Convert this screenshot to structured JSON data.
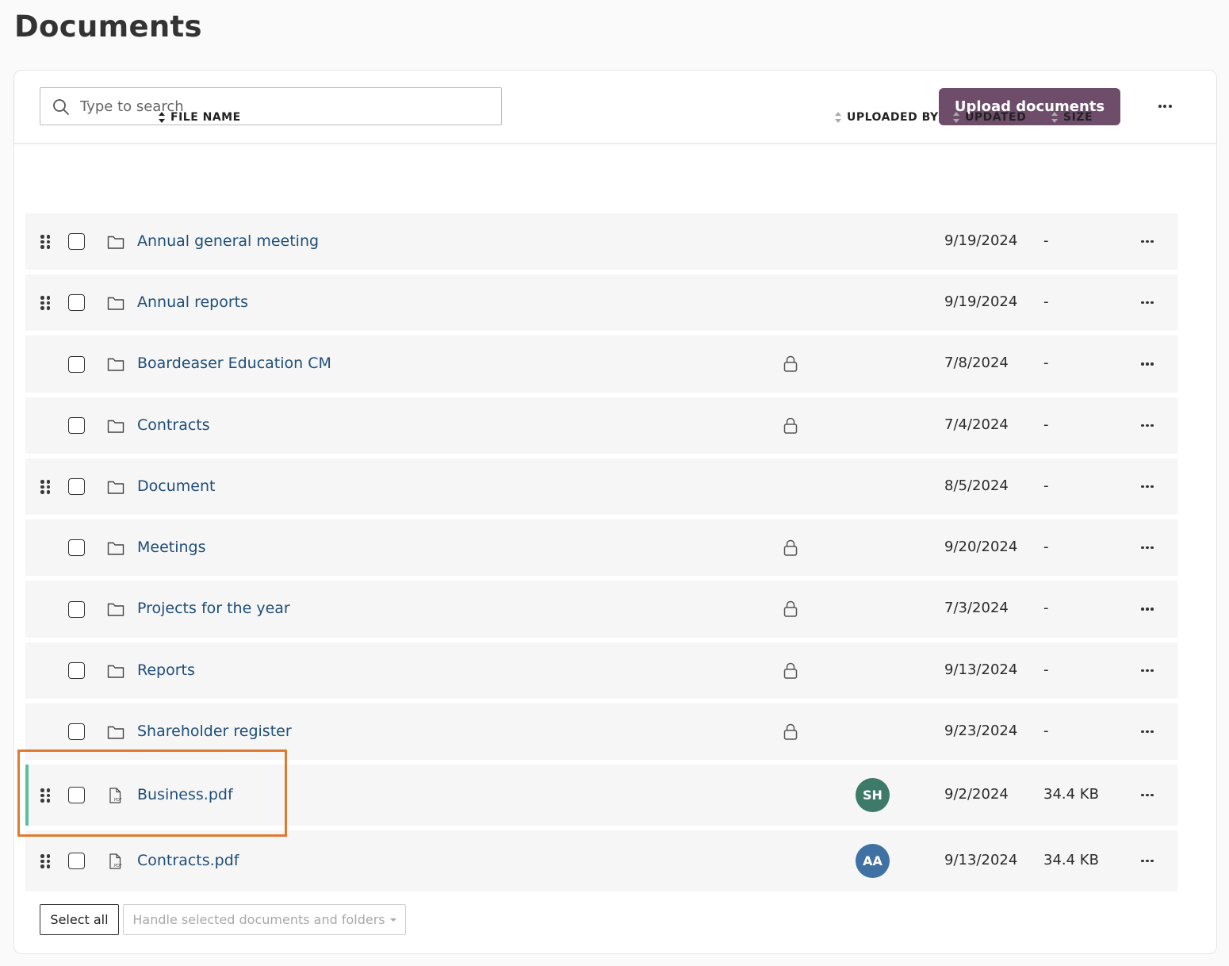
{
  "page": {
    "title": "Documents"
  },
  "toolbar": {
    "search_placeholder": "Type to search",
    "search_value": "",
    "upload_label": "Upload documents"
  },
  "columns": {
    "file_name": "FILE NAME",
    "uploaded_by": "UPLOADED BY",
    "updated": "UPDATED",
    "size": "SIZE"
  },
  "rows": [
    {
      "name": "Annual general meeting",
      "type": "folder",
      "draggable": true,
      "locked": false,
      "uploaded_by": "",
      "updated": "9/19/2024",
      "size": "-"
    },
    {
      "name": "Annual reports",
      "type": "folder",
      "draggable": true,
      "locked": false,
      "uploaded_by": "",
      "updated": "9/19/2024",
      "size": "-"
    },
    {
      "name": "Boardeaser Education CM",
      "type": "folder",
      "draggable": false,
      "locked": true,
      "uploaded_by": "",
      "updated": "7/8/2024",
      "size": "-"
    },
    {
      "name": "Contracts",
      "type": "folder",
      "draggable": false,
      "locked": true,
      "uploaded_by": "",
      "updated": "7/4/2024",
      "size": "-"
    },
    {
      "name": "Document",
      "type": "folder",
      "draggable": true,
      "locked": false,
      "uploaded_by": "",
      "updated": "8/5/2024",
      "size": "-"
    },
    {
      "name": "Meetings",
      "type": "folder",
      "draggable": false,
      "locked": true,
      "uploaded_by": "",
      "updated": "9/20/2024",
      "size": "-"
    },
    {
      "name": "Projects for the year",
      "type": "folder",
      "draggable": false,
      "locked": true,
      "uploaded_by": "",
      "updated": "7/3/2024",
      "size": "-"
    },
    {
      "name": "Reports",
      "type": "folder",
      "draggable": false,
      "locked": true,
      "uploaded_by": "",
      "updated": "9/13/2024",
      "size": "-"
    },
    {
      "name": "Shareholder register",
      "type": "folder",
      "draggable": false,
      "locked": true,
      "uploaded_by": "",
      "updated": "9/23/2024",
      "size": "-"
    },
    {
      "name": "Business.pdf",
      "type": "pdf",
      "draggable": true,
      "locked": false,
      "uploaded_by": "SH",
      "avatar_color": "#3d7a6a",
      "highlighted": true,
      "updated": "9/2/2024",
      "size": "34.4 KB"
    },
    {
      "name": "Contracts.pdf",
      "type": "pdf",
      "draggable": true,
      "locked": false,
      "uploaded_by": "AA",
      "avatar_color": "#3f72a3",
      "updated": "9/13/2024",
      "size": "34.4 KB"
    }
  ],
  "footer": {
    "select_all_label": "Select all",
    "handle_label": "Handle selected documents and folders"
  },
  "colors": {
    "accent": "#6e4d6b",
    "link": "#1f4e79",
    "row_bg": "#f6f6f6",
    "new_marker": "#5cc0a0",
    "highlight_box": "#e07a30"
  },
  "icons": {
    "search": "search-icon",
    "more": "more-horizontal-icon",
    "drag": "drag-handle-icon",
    "folder": "folder-icon",
    "pdf": "pdf-file-icon",
    "lock": "lock-icon",
    "sort": "sort-icon"
  }
}
